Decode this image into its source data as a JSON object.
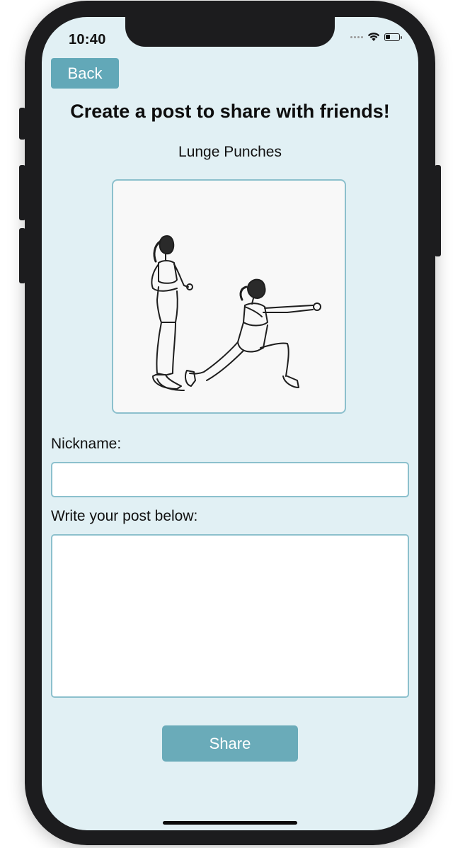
{
  "status_bar": {
    "time": "10:40",
    "icons": [
      "signal-dots-icon",
      "wifi-icon",
      "battery-icon"
    ]
  },
  "header": {
    "back_label": "Back",
    "title": "Create a post to share with friends!"
  },
  "exercise": {
    "name": "Lunge Punches",
    "image_icon": "lunge-punch-illustration"
  },
  "form": {
    "nickname_label": "Nickname:",
    "nickname_value": "",
    "nickname_placeholder": "",
    "post_label": "Write your post below:",
    "post_value": "",
    "post_placeholder": "",
    "share_label": "Share"
  },
  "colors": {
    "background": "#e1f0f4",
    "accent": "#62a8b8",
    "input_border": "#8cc0cd"
  }
}
